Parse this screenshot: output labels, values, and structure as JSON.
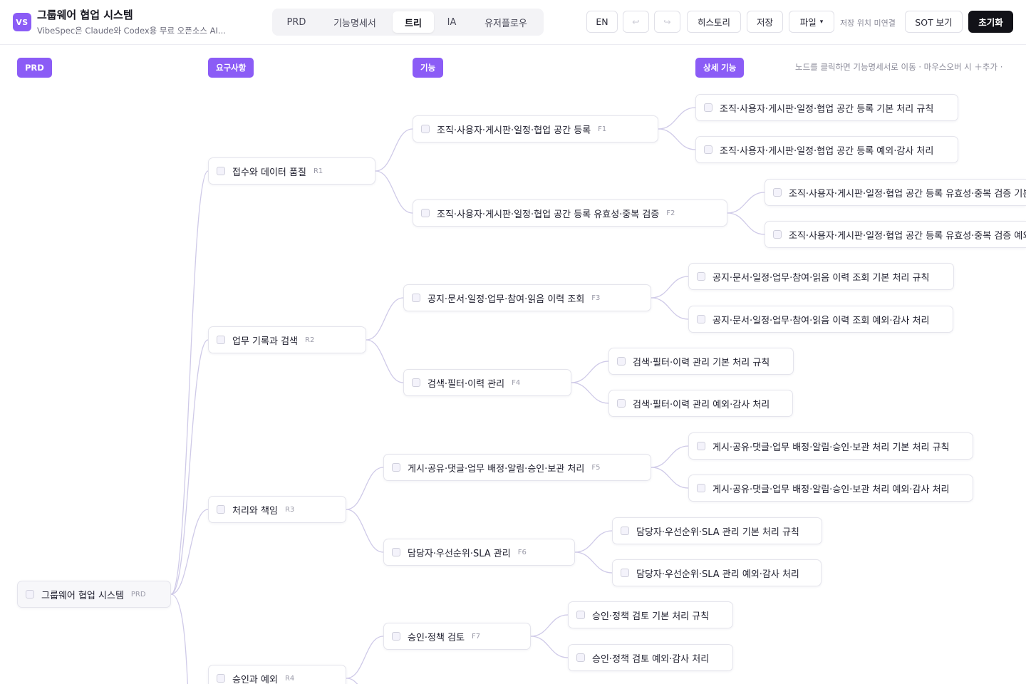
{
  "header": {
    "logo": "VS",
    "title": "그룹웨어 협업 시스템",
    "subtitle": "VibeSpec은 Claude와 Codex용 무료 오픈소스 AI...",
    "tabs": [
      {
        "label": "PRD",
        "active": false
      },
      {
        "label": "기능명세서",
        "active": false
      },
      {
        "label": "트리",
        "active": true
      },
      {
        "label": "IA",
        "active": false
      },
      {
        "label": "유저플로우",
        "active": false
      }
    ],
    "lang_button": "EN",
    "undo_icon": "↩",
    "redo_icon": "↪",
    "history_button": "히스토리",
    "save_button": "저장",
    "file_button": "파일",
    "file_caret": "▾",
    "save_location": "저장 위치 미연결",
    "sot_button": "SOT 보기",
    "reset_button": "초기화"
  },
  "canvas": {
    "columns": [
      "PRD",
      "요구사항",
      "기능",
      "상세 기능"
    ],
    "hint": "노드를 클릭하면 기능명세서로 이동 · 마우스오버 시 ＋추가 ·",
    "root": {
      "label": "그룹웨어 협업 시스템",
      "tag": "PRD"
    },
    "requirements": [
      {
        "label": "접수와 데이터 품질",
        "tag": "R1"
      },
      {
        "label": "업무 기록과 검색",
        "tag": "R2"
      },
      {
        "label": "처리와 책임",
        "tag": "R3"
      },
      {
        "label": "승인과 예외",
        "tag": "R4"
      }
    ],
    "features": [
      {
        "label": "조직·사용자·게시판·일정·협업 공간 등록",
        "tag": "F1"
      },
      {
        "label": "조직·사용자·게시판·일정·협업 공간 등록 유효성·중복 검증",
        "tag": "F2"
      },
      {
        "label": "공지·문서·일정·업무·참여·읽음 이력 조회",
        "tag": "F3"
      },
      {
        "label": "검색·필터·이력 관리",
        "tag": "F4"
      },
      {
        "label": "게시·공유·댓글·업무 배정·알림·승인·보관 처리",
        "tag": "F5"
      },
      {
        "label": "담당자·우선순위·SLA 관리",
        "tag": "F6"
      },
      {
        "label": "승인·정책 검토",
        "tag": "F7"
      }
    ],
    "details": [
      "조직·사용자·게시판·일정·협업 공간 등록 기본 처리 규칙",
      "조직·사용자·게시판·일정·협업 공간 등록 예외·감사 처리",
      "조직·사용자·게시판·일정·협업 공간 등록 유효성·중복 검증 기본 처리 규칙",
      "조직·사용자·게시판·일정·협업 공간 등록 유효성·중복 검증 예외·감사 처리",
      "공지·문서·일정·업무·참여·읽음 이력 조회 기본 처리 규칙",
      "공지·문서·일정·업무·참여·읽음 이력 조회 예외·감사 처리",
      "검색·필터·이력 관리 기본 처리 규칙",
      "검색·필터·이력 관리 예외·감사 처리",
      "게시·공유·댓글·업무 배정·알림·승인·보관 처리 기본 처리 규칙",
      "게시·공유·댓글·업무 배정·알림·승인·보관 처리 예외·감사 처리",
      "담당자·우선순위·SLA 관리 기본 처리 규칙",
      "담당자·우선순위·SLA 관리 예외·감사 처리",
      "승인·정책 검토 기본 처리 규칙",
      "승인·정책 검토 예외·감사 처리"
    ]
  }
}
